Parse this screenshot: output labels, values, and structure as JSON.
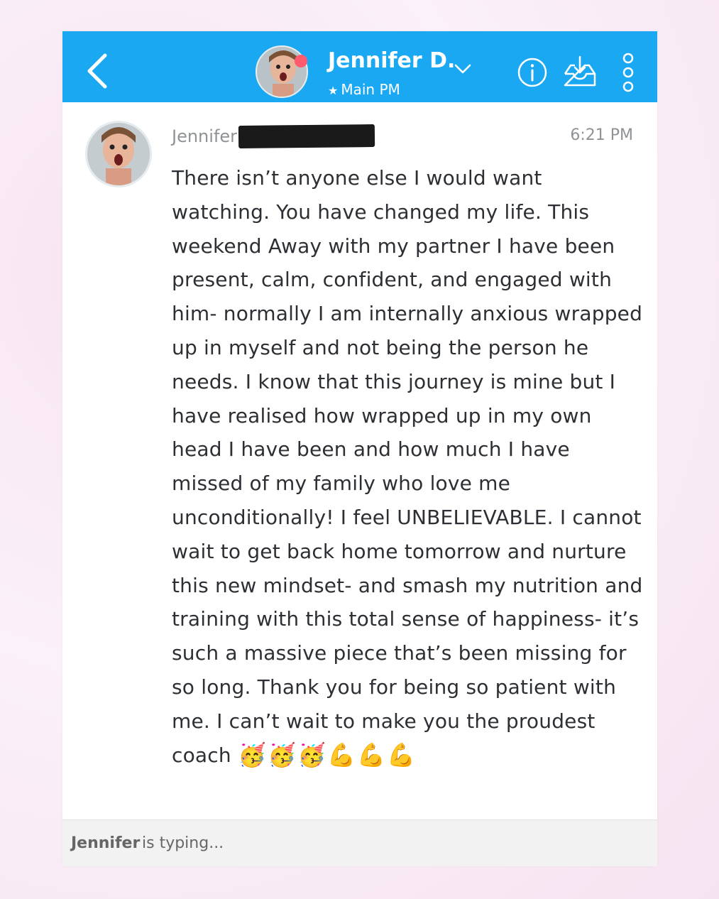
{
  "header": {
    "name": "Jennifer D.",
    "subtitle": "Main PM"
  },
  "colors": {
    "accent": "#1ba8f3",
    "presence": "#ff5a6e",
    "background": "#fbeef7"
  },
  "icons": {
    "back": "chevron-left-icon",
    "dropdown": "chevron-down-icon",
    "info": "info-icon",
    "inbox": "inbox-download-icon",
    "more": "more-vertical-icon",
    "star": "star-icon"
  },
  "message": {
    "sender": "Jennifer",
    "time": "6:21 PM",
    "text": "There isn’t anyone else I would want watching. You have changed my life. This weekend Away with my partner I have been present, calm, confident, and engaged with him- normally I am internally anxious wrapped up in myself and not being the person he needs. I know that this journey is mine but I have realised how wrapped up in my own head I have been and how much I have missed of my family who love me unconditionally! I feel UNBELIEVABLE. I cannot wait to get back home tomorrow and nurture this new mindset- and smash my nutrition and training with this total sense of happiness- it’s such a massive piece that’s been missing for so long. Thank you for being so patient with me.  I can’t wait to make you the proudest coach",
    "emojis": [
      "🥳",
      "🥳",
      "🥳",
      "💪",
      "💪",
      "💪"
    ]
  },
  "typing": {
    "name": "Jennifer",
    "suffix": "is typing..."
  }
}
